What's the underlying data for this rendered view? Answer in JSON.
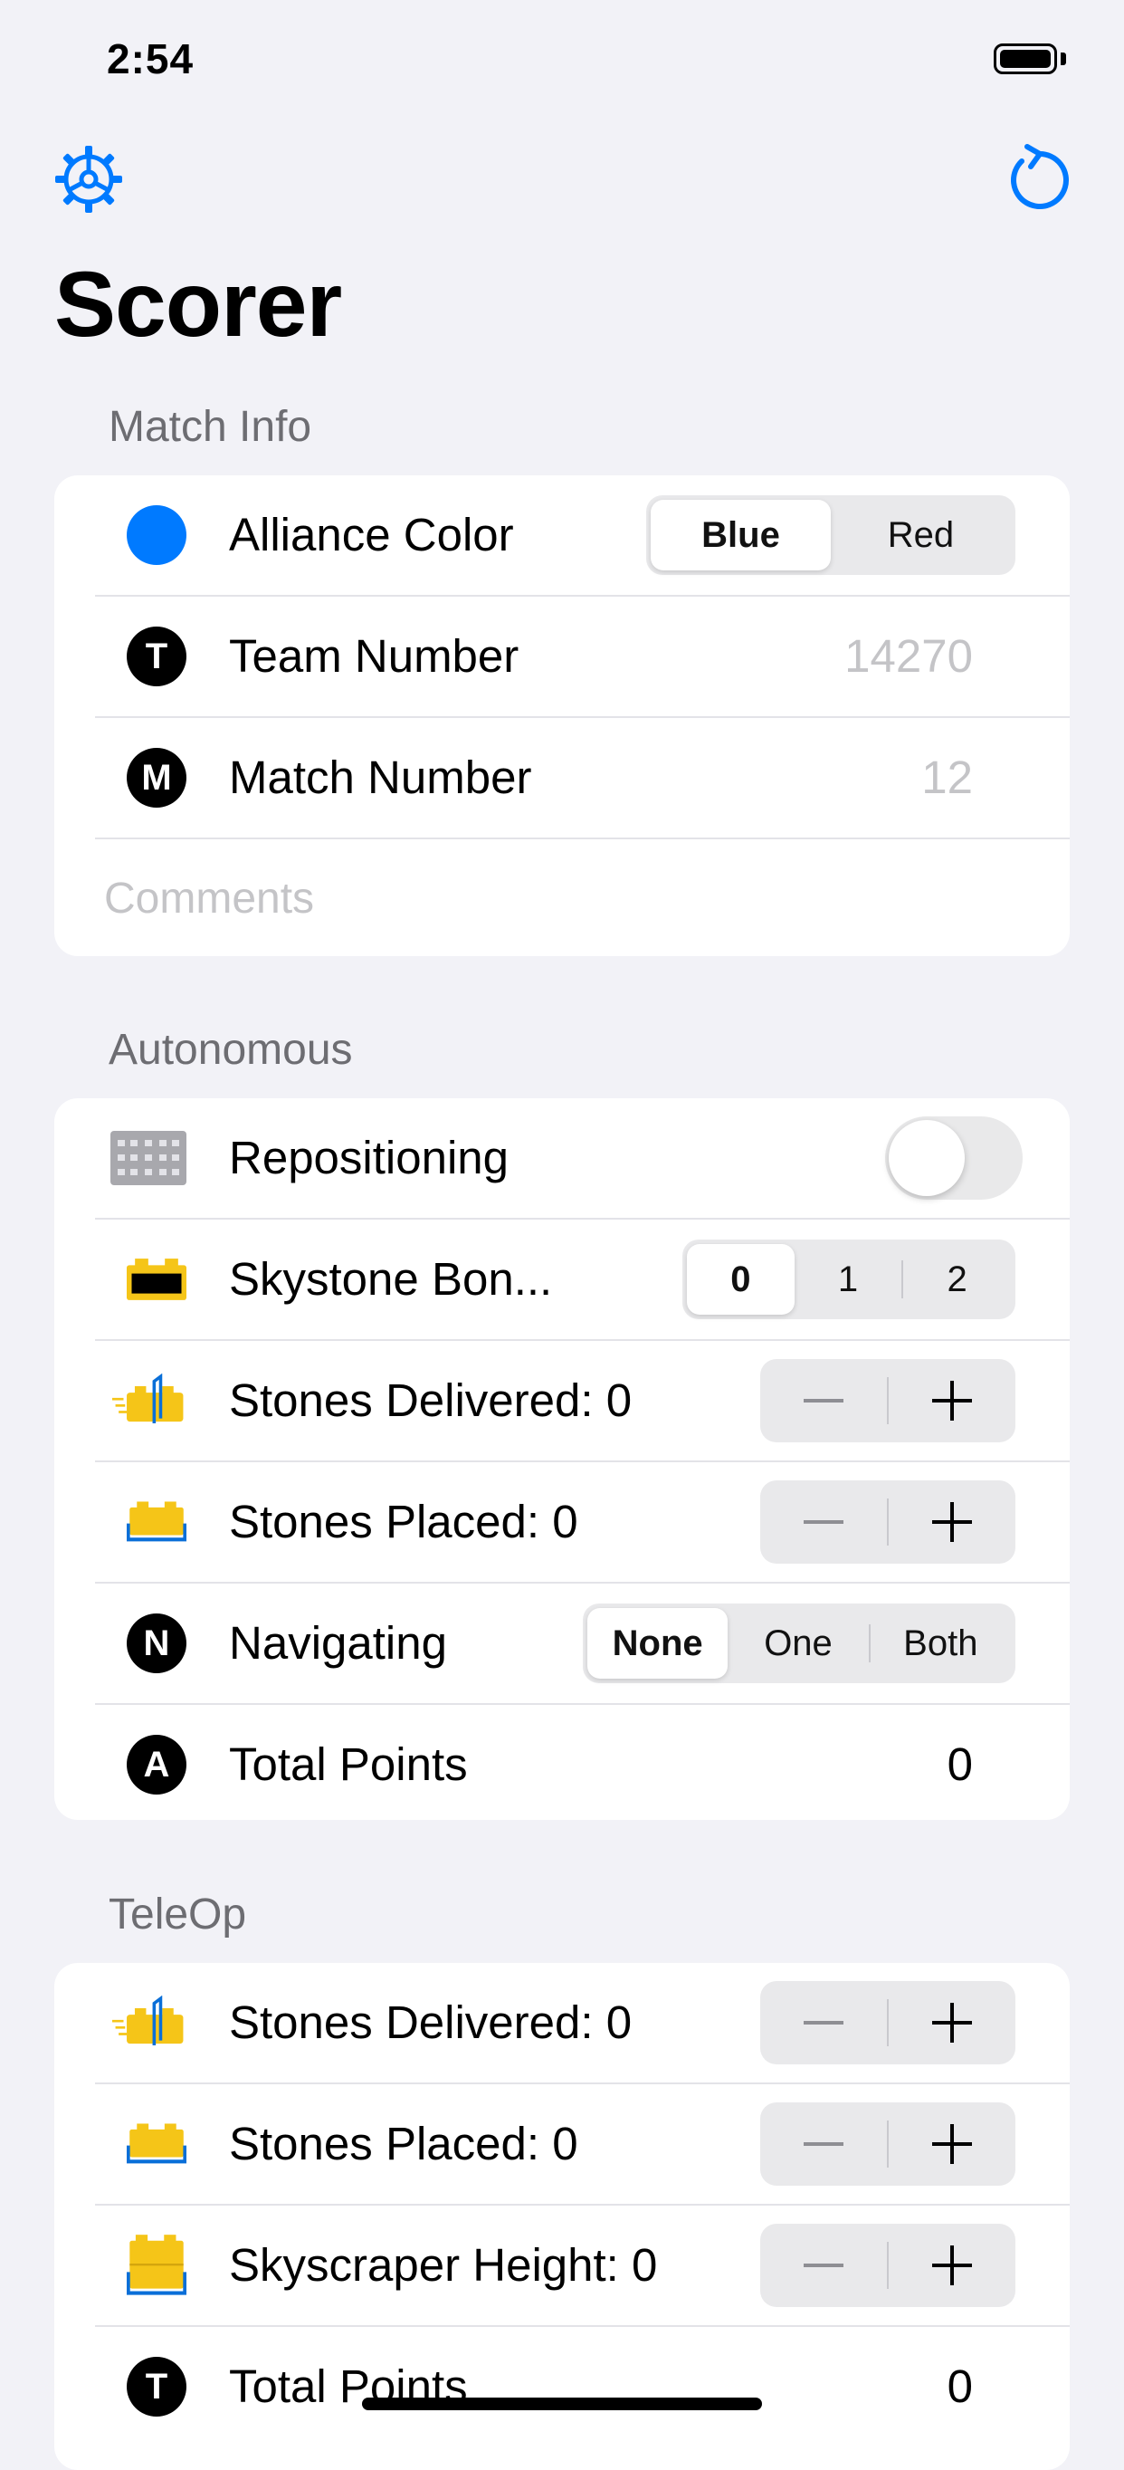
{
  "status_bar": {
    "time": "2:54"
  },
  "nav": {
    "title": "Scorer",
    "left_icon": "gear-icon",
    "right_icon": "reset-icon"
  },
  "colors": {
    "accent": "#007aff",
    "background": "#f2f2f7",
    "section_header": "#6d6d72"
  },
  "match_info": {
    "header": "Match Info",
    "alliance": {
      "label": "Alliance Color",
      "options": [
        "Blue",
        "Red"
      ],
      "selected": "Blue"
    },
    "team": {
      "label": "Team Number",
      "placeholder": "14270"
    },
    "match": {
      "label": "Match Number",
      "placeholder": "12"
    },
    "comments_placeholder": "Comments"
  },
  "autonomous": {
    "header": "Autonomous",
    "repositioning": {
      "label": "Repositioning",
      "on": false
    },
    "skystone": {
      "label": "Skystone Bon...",
      "options": [
        "0",
        "1",
        "2"
      ],
      "selected": "0"
    },
    "delivered": {
      "label": "Stones Delivered: 0"
    },
    "placed": {
      "label": "Stones Placed: 0"
    },
    "navigating": {
      "label": "Navigating",
      "options": [
        "None",
        "One",
        "Both"
      ],
      "selected": "None"
    },
    "total": {
      "label": "Total Points",
      "value": "0"
    }
  },
  "teleop": {
    "header": "TeleOp",
    "delivered": {
      "label": "Stones Delivered: 0"
    },
    "placed": {
      "label": "Stones Placed: 0"
    },
    "skyscraper": {
      "label": "Skyscraper Height: 0"
    },
    "total": {
      "label": "Total Points",
      "value": "0"
    }
  },
  "icon_letters": {
    "team": "T",
    "match": "M",
    "navigating": "N",
    "auto_total": "A",
    "teleop_total": "T"
  }
}
